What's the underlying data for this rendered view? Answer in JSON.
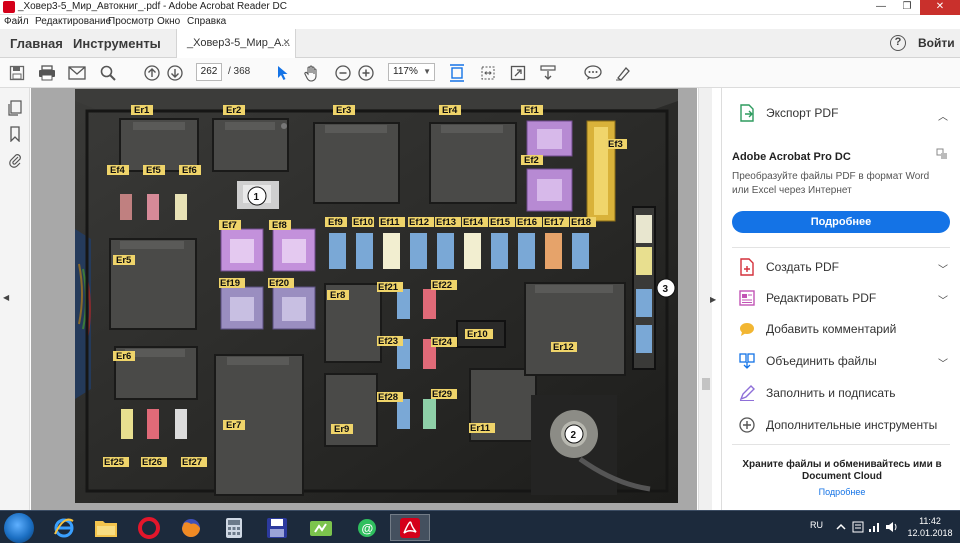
{
  "window": {
    "title": "_Ховер3-5_Мир_Автокниг_.pdf - Adobe Acrobat Reader DC",
    "controls": {
      "minimize": "—",
      "maximize": "❐",
      "close": "✕"
    }
  },
  "menu": [
    "Файл",
    "Редактирование",
    "Просмотр",
    "Окно",
    "Справка"
  ],
  "tabs": {
    "home": "Главная",
    "tools": "Инструменты",
    "document": "_Ховер3-5_Мир_А...",
    "close": "×",
    "help": "?",
    "login": "Войти"
  },
  "toolbar": {
    "page_current": "262",
    "page_total": "/ 368",
    "zoom": "117%",
    "zoom_arrow": "▼"
  },
  "document": {
    "photo_labels": {
      "relays": [
        "Er1",
        "Er2",
        "Er3",
        "Er4",
        "Er5",
        "Er6",
        "Er7",
        "Er8",
        "Er9",
        "Er10",
        "Er11",
        "Er12"
      ],
      "fuses": [
        "Ef1",
        "Ef2",
        "Ef3",
        "Ef4",
        "Ef5",
        "Ef6",
        "Ef7",
        "Ef8",
        "Ef9",
        "Ef10",
        "Ef11",
        "Ef12",
        "Ef13",
        "Ef14",
        "Ef15",
        "Ef16",
        "Ef17",
        "Ef18",
        "Ef19",
        "Ef20",
        "Ef21",
        "Ef22",
        "Ef23",
        "Ef24",
        "Ef25",
        "Ef26",
        "Ef27",
        "Ef28",
        "Ef29"
      ],
      "callouts": [
        "1",
        "2",
        "3"
      ]
    }
  },
  "right_pane": {
    "export": "Экспорт PDF",
    "promo_title": "Adobe Acrobat Pro DC",
    "promo_text": "Преобразуйте файлы PDF в формат Word или Excel через Интернет",
    "promo_button": "Подробнее",
    "tools": [
      "Создать PDF",
      "Редактировать PDF",
      "Добавить комментарий",
      "Объединить файлы",
      "Заполнить и подписать",
      "Дополнительные инструменты"
    ],
    "cloud_text": "Храните файлы и обменивайтесь ими в Document Cloud",
    "cloud_link": "Подробнее"
  },
  "taskbar": {
    "lang": "RU",
    "time": "11:42",
    "date": "12.01.2018"
  },
  "colors": {
    "accent": "#1473e6",
    "close": "#c9302c",
    "taskbar": "#1c2a3c"
  }
}
